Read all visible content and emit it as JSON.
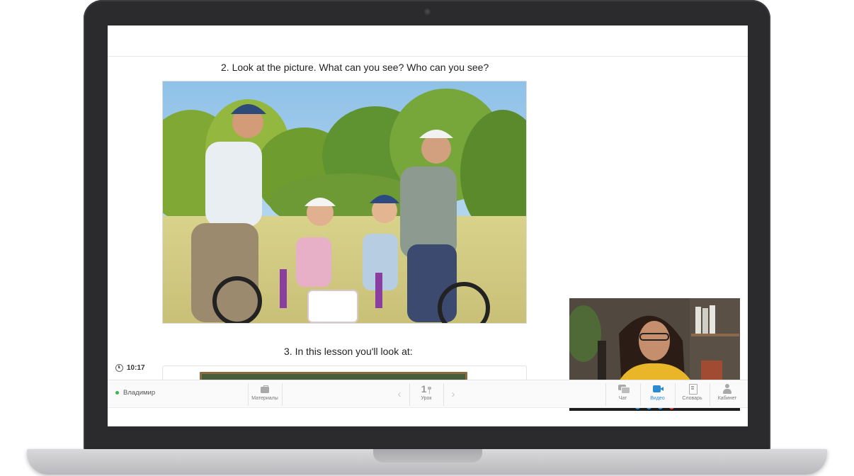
{
  "lesson": {
    "task2_heading": "2. Look at the picture. What can you see? Who can you see?",
    "task3_heading": "3. In this lesson you'll look at:"
  },
  "timer": {
    "time": "10:17"
  },
  "toolbar": {
    "user_name": "Владимир",
    "materials_label": "Материалы",
    "lesson_number": "1",
    "lesson_label": "Урок",
    "chat_label": "Чат",
    "video_label": "Видео",
    "dictionary_label": "Словарь",
    "cabinet_label": "Кабинет"
  },
  "icons": {
    "clock": "clock-icon",
    "materials": "briefcase-icon",
    "lesson_pin": "pin-icon",
    "chat": "chat-icon",
    "video": "videocam-icon",
    "dictionary": "book-icon",
    "cabinet": "person-icon"
  },
  "colors": {
    "accent": "#2a8ad4",
    "online_status": "#3cb64a",
    "hangup": "#e24b4b"
  }
}
